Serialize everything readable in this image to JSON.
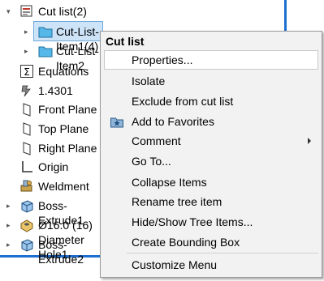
{
  "tree": {
    "items": [
      {
        "label": "Cut list(2)",
        "icon": "cut-list-icon"
      },
      {
        "label": "Cut-List-Item1(4)",
        "icon": "folder-icon"
      },
      {
        "label": "Cut-List-Item2",
        "icon": "folder-icon"
      },
      {
        "label": "Equations",
        "icon": "sigma-icon"
      },
      {
        "label": "1.4301",
        "icon": "material-icon"
      },
      {
        "label": "Front Plane",
        "icon": "plane-icon"
      },
      {
        "label": "Top Plane",
        "icon": "plane-icon"
      },
      {
        "label": "Right Plane",
        "icon": "plane-icon"
      },
      {
        "label": "Origin",
        "icon": "origin-icon"
      },
      {
        "label": "Weldment",
        "icon": "weldment-icon"
      },
      {
        "label": "Boss-Extrude1",
        "icon": "boss-extrude-icon"
      },
      {
        "label": "Ø16.0 (16) Diameter Hole1",
        "icon": "hole-icon"
      },
      {
        "label": "Boss-Extrude2",
        "icon": "boss-extrude-icon"
      }
    ]
  },
  "menu": {
    "title": "Cut list",
    "items": [
      {
        "label": "Properties..."
      },
      {
        "label": "Isolate"
      },
      {
        "label": "Exclude from cut list"
      },
      {
        "label": "Add to Favorites",
        "icon": "favorites-star-icon"
      },
      {
        "label": "Comment",
        "submenu": true
      },
      {
        "label": "Go To..."
      },
      {
        "label": "Collapse Items"
      },
      {
        "label": "Rename tree item"
      },
      {
        "label": "Hide/Show Tree Items..."
      },
      {
        "label": "Create Bounding Box"
      },
      {
        "label": "Customize Menu"
      }
    ]
  },
  "colors": {
    "accent": "#1d6fd0",
    "selection": "#cce3f8"
  }
}
